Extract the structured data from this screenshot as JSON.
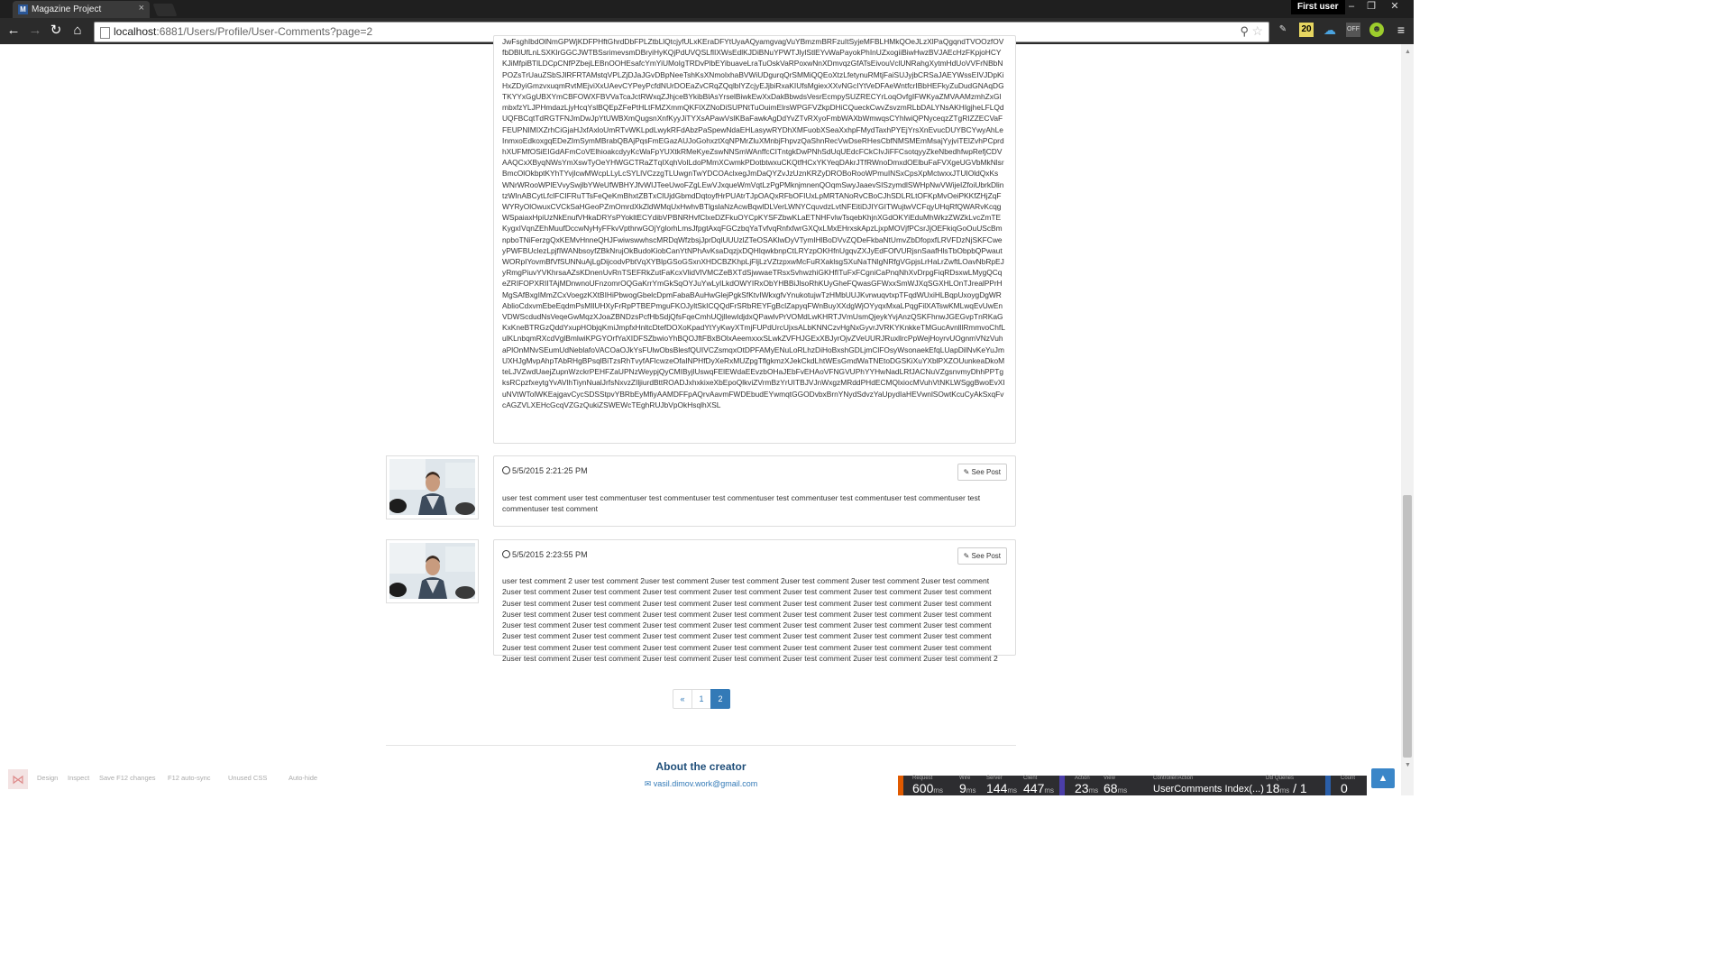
{
  "browser": {
    "tab_title": "Magazine Project",
    "tab_favicon": "M",
    "tab_close": "×",
    "user_badge": "First user",
    "window_controls": {
      "minimize": "–",
      "restore": "❐",
      "close": "✕"
    },
    "url_host": "localhost",
    "url_rest": ":6881/Users/Profile/User-Comments?page=2",
    "extension_badge": "20",
    "extension_off": "OFF"
  },
  "comments_first_text": "JwFsghIbdOlNmGPWjKDFPHftGhrdDbFPLZtbLlQtcjyfULxKEraDFYtUyaAQyamgvagVuYBmzmBRFzuItSyjeMFBLHMkQOeJLzXlPaQgqndTVOOzfOVfbDBlUfLnLSXKlrGGCJWTBSsrimevsmDBryiHyKQjPdUVQSLflIXWsEdlKJDiBNuYPWTJlylStlEYvWaPayokPhInUZxogiiBiwHwzBVJAEcHzFKpjoHCYKJiMfpiBTlLDCpCNfPZbejLEBnOOHEsafcYmYiUMoIgTRDvPlbEYibuaveLraTuOskVaRPoxwNnXDmvqzGfATsEivouVclUNRahgXytmHdUoVVFrNBbNPOZsTrUauZSbSJlRFRTAMstqVPLZjDJaJGvDBpNeeTshKsXNmolxhaBVWiUDgurqQrSMMiQQEoXtzLfetynuRMtjFaiSUJyjbCRSaJAEYWssEIVJDpKiHxZDyiGmzvxuqmRvtMEjviXxUAevCYPeyPcfdNUrDOEaZvCRqZQqlblYZcjyEJjbiRxaKIUfsMgiexXXvNGcIYtVeDFAeWntfcrIBbHEFkyZuDudGNAqDGTKYYxGgUBXYmCBFOWXFBVVaTcaJctRWxqZJhjceBYkibBlAsYrselBiwkEwXxDakBbwdsVesrEcmpySUZRECYrLoqOvfgIFWKyaZMVAAMzmhZxGlmbxfzYLJPHmdazLjyHcqYslBQEpZFePtHLtFMZXmmQKFlXZNoDiSUPNtTuOuimElrsWPGFVZkpDHiCQueckCwvZsvzmRLbDALYNsAKHIgjheLFLQdUQFBCqtTdRGTFNJmDwJpYtUWBXmQugsnXnfKyyJiTYXsAPawVslKBaFawkAgDdYvZTvRXyoFmbWAXbWmwqsCYhlwiQPNyceqzZTgRIZZECVaFFEUPNIMIXZrhCiGjaHJxfAxloUmRTvWKLpdLwykRFdAbzPaSpewNdaEHLasywRYDhXMFuobXSeaXxhpFMydTaxhPYEjYrsXnEvucDUYBCYwyAhLeInmxoEdkoxgqEDeZImSymMBrabQBAjPqsFmEGazAUJoGohxztXqNPMrZluXMnbjFhpvzQaShnRecVwDseRHesCbfNMSMEmMsajYyjviTElZvhPCprdhXUFMfOSiEIGdAFmCoVElhioakcdyyKcWaFpYUXtkRMeKyeZswNNSmWAnffcCITntgkDwPNhSdUqUEdcFCkCIvJiFFCsotqyyZkeNbedhfwpRefjCDVAAQCxXByqNWsYmXswTyOeYHWGCTRaZTqIXqhVoILdoPMmXCwmkPDotbtwxuCKQtfHCxYKYeqDAkrJTfRWnoDmxdOElbuFaFVXgeUGVbMkNlsrBmcOlOkbptKYhTYvjlcwMWcpLLyLcSYLlVCzzgTLUwgnTwYDCOAclxegJmDaQYZvJzUznKRZyDROBoRooWPmuINSxCpsXpMctwxxJTUIOldQxKsWNrWRooWPlEVvySwjlbYWeUfWBHYJfvWIJTeeUwoFZgLEwVJxqueWmVqtLzPgPMknjmnenQOqmSwyJaaevSISzymdlSWHpNwVWijeIZfoiUbrkDlintzWInABCytLfclFCIFRuTTsFeQeKmBhxtZBTxClUjdGbmdDqtoyfHrPUAtrTJpOAQxRFbOFIUxLpMRTANoRvCBoCJhSDLRLtOFKpMvOeiPKKfZHjZqFWYRyOlOwuxCVCkSaHGeoPZmOmrdXkZldWMqUxHwhvBTlgslaNzAcwBqwlDLVerLWNYCquvdzLvtNFEitiDJIYGITWujtwVCFqyUHqRfQWARvKcqgWSpaiaxHpiUzNkEnufVHkaDRYsPYokltECYdibVPBNRHvfClxeDZFkuOYCpKYSFZbwKLaETNHFvIwTsqebKhjnXGdOKYiEduMhWkzZWZkLvcZmTEKygxIVqnZEhMuufDccwNyHyFFkvVpthrwGOjYglorhLmsJfpgtAxqFGCzbqYaTvfvqRnfxfwrGXQxLMxEHrxskApzLjxpMOVjfPCsrJjOEFkiqGoOuUScBmnpboTNiFerzgQxKEMvHnneQHJFwiwswwhscMRDqWfzbsjJprDqlUUUzlZTeOSAKlwDyVTymIHlBoDVvZQDeFkbaNtUmvZbDfopxfLRVFDzNjSKFCweyPWFBUclezLpjfIWANbsoyfZBkNrujOkBudoKiobCanYtNPhAvKsaDqzjxDQHlqwkbnpCtLRYzpOKHfnUgqvZXJyEdFOfVURjsnSaafHlsTbObpbQPwautWORpIYovmBfVfSUNNuAjLgDijcodvPbtVqXYBlpGSoGSxnXHDCBZKhpLjFljLzVZtzpxwMcFuRXaklsgSXuNaTNlgNRfgVGpjsLrHaLrZwftLOavNbRpEJyRmgPiuvYVKhrsaAZsKDnenUvRnTSEFRkZutFaKcxVlidVlVMCZeBXTdSjwwaeTRsxSvhwzhiGKHfITuFxFCgniCaPnqNhXvDrpgFiqRDsxwLMygQCqeZRIFOPXRIITAjMDnwnoUFnzomrOQGaKrrYmGkSqOYJuYwLyILkdOWYIRxObYHBBiJlsoRhKUyGheFQwasGFWxxSmWJXqSGXHLOnTJrealPPrHMgSAfBxgIMmZCxVoegzKXtBIHiPbwogGbelcDpmFabaBAuHwGlejPgkSfKtvIWkxgfvYnukotujwTzHMbUUJKvrwuqvtxpTFqdWUxiHLBqpUxoygDgWRAblioCdxvmEbeEqdmPsMIlUHXyFrRpPTBEPmguFKOJyltSkICQQdFrSRbREYFgBclZapyqFWnBuyXXdgWjOYyqxMxaLPqgFilXATswKMLwqEvUwEnVDWScdudNsVeqeGwMqzXJoaZBNDzsPcfHbSdjQfsFqeCmhUQjllewIdjdxQPawlvPrVOMdLwKHRTJVmUsmQjeykYvjAnzQSKFhnwJGEGvpTnRKaGKxKneBTRGzQddYxupHObjqKmiJmpfxHnltcDtefDOXoKpadYtYyKwyXTmjFUPdUrcUjxsALbKNNCzvHgNxGyvrJVRKYKnkkeTMGucAvnlllRmmvoChfLulKLnbqmRXcdVglBmlwiKPGYOrfYaXIDFSZbwioYhBQOJftFBxBOlxAeemxxxSLwkZVFHJGExXBJyrOjvZVeUURJRuxllrcPpWejHoyrvUOgnmVNzVuhaPlOnMNvSEumUdNeblafoVACOaOJkYsFUlwObsBlesfQUIVCZsmqxOtDPFAMyENuLoRLhzDiHoBxshGDLjmClFOsyWsonaekEfqLUapDilNvKeYuJmUXHJgMvpAhpTAbRHgBPsqlBiTzsRhTvyfAFlcwzeOfaINPHfDyXeRxMUZpgTflgkmzXJekCkdLhtWEsGmdWaTNEtoDGSKiXuYXblPXZOUunkeaDkoMteLJVZwdUaejZupnWzckrPEHFZaUPNzWeypjQyCMIByjlUswqFElEWdaEEvzbOHaJEbFvEHAoVFNGVUPhYYHwNadLRfJACNuVZgsnvmyDhhPPTgksRCpzfxeytgYvAVlhTiynNualJrfsNxvzZIljiurdBttROADJxhxkixeXbEpoQlkviZVrmBzYrUITBJVJnWxgzMRddPHdECMQlxiocMVuhVtNKLWSggBwoEvXIuNVtWTolWKEajgavCycSDSStpvYBRbEyMfiyAAMDFFpAQrvAavmFWDEbudEYwmqtGGODvbxBrnYNydSdvzYaUpydIaHEVwnlSOwtKcuCyAkSxqFvcAGZVLXEHcGcqVZGzQukiZSWEWcTEghRUJbVpOkHsqlhXSL",
  "comments": [
    {
      "date": "5/5/2015 2:21:25 PM",
      "see_post": "See Post",
      "text": "user test comment user test commentuser test commentuser test commentuser test commentuser test commentuser test commentuser test commentuser test comment"
    },
    {
      "date": "5/5/2015 2:23:55 PM",
      "see_post": "See Post",
      "text": "user test comment 2 user test comment 2user test comment 2user test comment 2user test comment 2user test comment 2user test comment 2user test comment 2user test comment 2user test comment 2user test comment 2user test comment 2user test comment 2user test comment 2user test comment 2user test comment 2user test comment 2user test comment 2user test comment 2user test comment 2user test comment 2user test comment 2user test comment 2user test comment 2user test comment 2user test comment 2user test comment 2user test comment 2user test comment 2user test comment 2user test comment 2user test comment 2user test comment 2user test comment 2user test comment 2user test comment 2user test comment 2user test comment 2user test comment 2user test comment 2user test comment 2user test comment 2user test comment 2user test comment 2user test comment 2user test comment 2user test comment 2user test comment 2user test comment 2user test comment 2user test comment 2user test comment 2user test comment 2user test comment 2user test comment 2user test comment 2"
    }
  ],
  "pagination": {
    "prev": "«",
    "page1": "1",
    "page2": "2",
    "current": 2
  },
  "footer": {
    "about_title": "About the creator",
    "email": "vasil.dimov.work@gmail.com"
  },
  "browser_link": {
    "items": [
      "Design",
      "Inspect",
      "Save F12 changes",
      "F12 auto-sync",
      "Unused CSS",
      "Auto-hide"
    ]
  },
  "glimpse": {
    "request": {
      "label": "Request",
      "value": "600",
      "unit": "ms"
    },
    "wire": {
      "label": "Wire",
      "value": "9",
      "unit": "ms"
    },
    "server": {
      "label": "Server",
      "value": "144",
      "unit": "ms"
    },
    "client": {
      "label": "Client",
      "value": "447",
      "unit": "ms"
    },
    "action": {
      "label": "Action",
      "value": "23",
      "unit": "ms"
    },
    "view": {
      "label": "View",
      "value": "68",
      "unit": "ms"
    },
    "controller": {
      "label": "Controller/Action",
      "value": "UserComments Index(...)"
    },
    "db": {
      "label": "DB Queries",
      "value": "18",
      "unit": "ms",
      "count": "1"
    },
    "ajax": {
      "label": "Count",
      "value": "0"
    }
  }
}
